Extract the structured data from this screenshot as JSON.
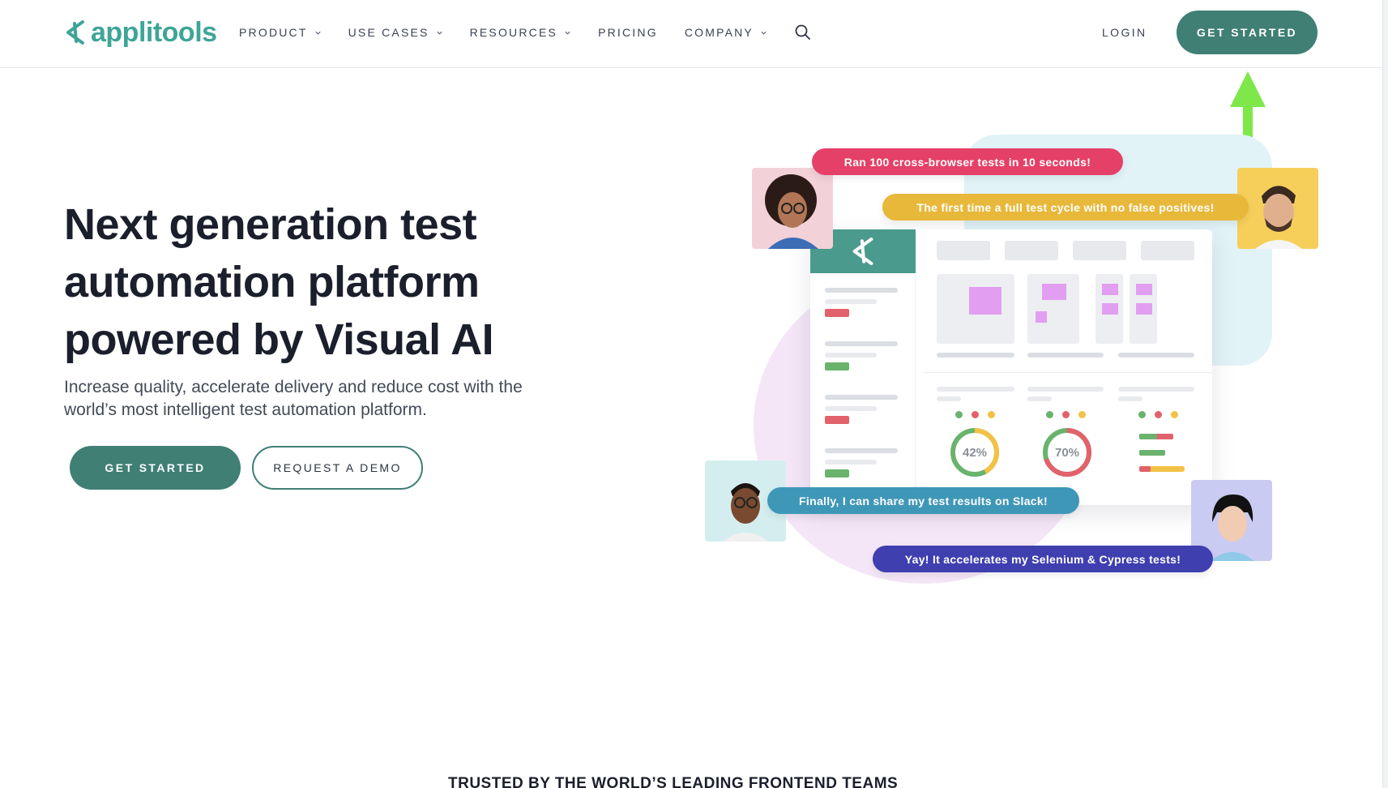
{
  "brand": {
    "name": "applitools",
    "color": "#3ea597"
  },
  "nav": {
    "items": [
      {
        "label": "PRODUCT",
        "dropdown": true
      },
      {
        "label": "USE CASES",
        "dropdown": true
      },
      {
        "label": "RESOURCES",
        "dropdown": true
      },
      {
        "label": "PRICING",
        "dropdown": false
      },
      {
        "label": "COMPANY",
        "dropdown": true
      }
    ],
    "search_icon": "search-icon",
    "login_label": "LOGIN",
    "cta_label": "GET STARTED"
  },
  "hero": {
    "title_lines": [
      "Next generation test",
      "automation platform",
      "powered by Visual AI"
    ],
    "subtitle_lines": [
      "Increase quality, accelerate delivery and reduce cost with the",
      "world’s most intelligent test automation platform."
    ],
    "primary_label": "GET STARTED",
    "secondary_label": "REQUEST A DEMO"
  },
  "illustration": {
    "bubbles": [
      "Ran 100 cross-browser tests in 10 seconds!",
      "The first time a full test cycle with no false positives!",
      "Finally, I can share my test results on Slack!",
      "Yay! It accelerates my Selenium & Cypress tests!"
    ],
    "gauges": [
      {
        "label": "42%",
        "value": 42
      },
      {
        "label": "70%",
        "value": 70
      }
    ]
  },
  "trusted_heading": "TRUSTED BY THE WORLD’S LEADING FRONTEND TEAMS",
  "colors": {
    "accent": "#3f7f74",
    "annotation_arrow": "#7ee84a"
  }
}
